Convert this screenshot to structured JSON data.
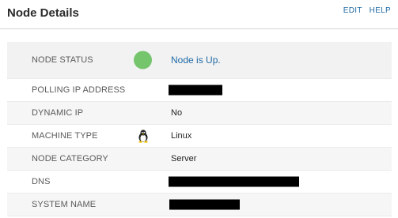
{
  "header": {
    "title": "Node Details",
    "edit_label": "EDIT",
    "help_label": "HELP"
  },
  "rows": [
    {
      "label": "NODE STATUS",
      "value": "Node is Up."
    },
    {
      "label": "POLLING IP ADDRESS",
      "value": "[redacted]"
    },
    {
      "label": "DYNAMIC IP",
      "value": "No"
    },
    {
      "label": "MACHINE TYPE",
      "value": "Linux"
    },
    {
      "label": "NODE CATEGORY",
      "value": "Server"
    },
    {
      "label": "DNS",
      "value": "[redacted]"
    },
    {
      "label": "SYSTEM NAME",
      "value": "[redacted]"
    }
  ],
  "icons": {
    "status": "green-status-dot-icon",
    "machine_type": "linux-penguin-icon"
  },
  "colors": {
    "status_up": "#74c56c",
    "link": "#1f6aa5"
  }
}
